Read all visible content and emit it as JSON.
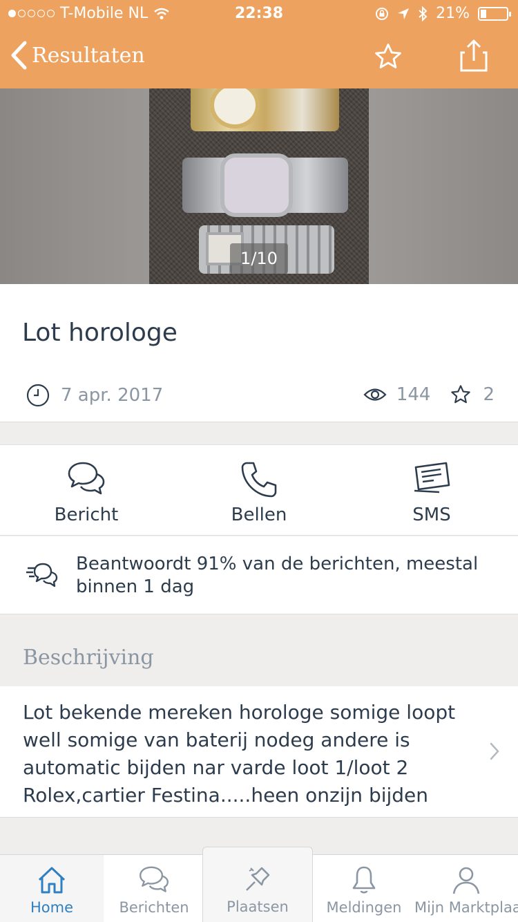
{
  "status_bar": {
    "carrier": "T-Mobile NL",
    "time": "22:38",
    "battery": "21%",
    "battery_level": 0.21
  },
  "nav": {
    "back_label": "Resultaten"
  },
  "gallery": {
    "counter": "1/10"
  },
  "listing": {
    "title": "Lot horologe",
    "date": "7 apr. 2017",
    "views": "144",
    "favorites": "2"
  },
  "contact": {
    "message_label": "Bericht",
    "call_label": "Bellen",
    "sms_label": "SMS"
  },
  "response_rate": {
    "text": "Beantwoordt 91% van de berichten, meestal binnen 1 dag"
  },
  "description": {
    "heading": "Beschrijving",
    "text": "Lot bekende mereken horologe somige loopt well somige van baterij nodeg andere is automatic bijden nar varde loot 1/loot 2 Rolex,cartier Festina.....heen onzijn bijden"
  },
  "tabs": {
    "home": "Home",
    "messages": "Berichten",
    "place": "Plaatsen",
    "notifications": "Meldingen",
    "account": "Mijn Marktplaats"
  },
  "colors": {
    "brand_orange": "#eea25f",
    "text_dark": "#2d3c4d",
    "text_muted": "#8b96a3",
    "active_tab": "#2f7fc1"
  }
}
